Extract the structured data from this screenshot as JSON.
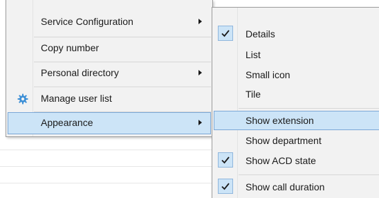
{
  "main_menu": {
    "items": [
      {
        "label": "Service Configuration",
        "has_submenu": true,
        "icon": null,
        "highlighted": false
      },
      {
        "label": "Copy number",
        "has_submenu": false,
        "icon": null,
        "highlighted": false
      },
      {
        "label": "Personal directory",
        "has_submenu": true,
        "icon": null,
        "highlighted": false
      },
      {
        "label": "Manage user list",
        "has_submenu": false,
        "icon": "gear-icon",
        "highlighted": false
      },
      {
        "label": "Appearance",
        "has_submenu": true,
        "icon": null,
        "highlighted": true
      }
    ]
  },
  "appearance_submenu": {
    "items": [
      {
        "label": "Details",
        "checked": true,
        "highlighted": false
      },
      {
        "label": "List",
        "checked": false,
        "highlighted": false
      },
      {
        "label": "Small icon",
        "checked": false,
        "highlighted": false
      },
      {
        "label": "Tile",
        "checked": false,
        "highlighted": false
      },
      {
        "label": "Show extension",
        "checked": false,
        "highlighted": true
      },
      {
        "label": "Show department",
        "checked": false,
        "highlighted": false
      },
      {
        "label": "Show ACD state",
        "checked": true,
        "highlighted": false
      },
      {
        "label": "Show call duration",
        "checked": true,
        "highlighted": false
      }
    ]
  },
  "colors": {
    "menu_bg": "#f2f2f2",
    "highlight_bg": "#cce4f7",
    "highlight_border": "#7aa7d6",
    "gear_icon": "#3c8fd6"
  }
}
